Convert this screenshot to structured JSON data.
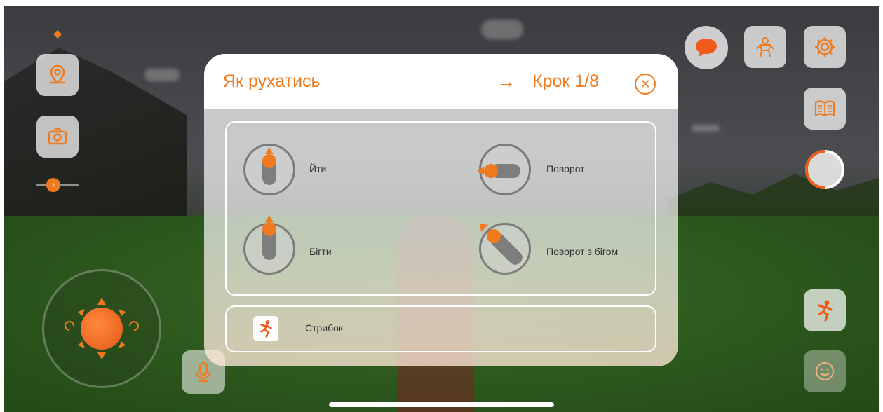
{
  "modal": {
    "title": "Як рухатись",
    "step_label": "Крок 1/8",
    "gestures": [
      {
        "label": "Йти"
      },
      {
        "label": "Поворот"
      },
      {
        "label": "Бігти"
      },
      {
        "label": "Поворот з бігом"
      }
    ],
    "jump": {
      "label": "Стрибок"
    }
  },
  "hud": {
    "progress_fraction": 0.5
  },
  "colors": {
    "accent": "#f07a1e",
    "modal_header_bg": "#ffffff",
    "panel_border": "#ffffff"
  },
  "icons": {
    "chat": "speech-bubble-icon",
    "avatar": "avatar-figure-icon",
    "settings": "gear-icon",
    "guide": "open-book-icon",
    "map": "map-pin-icon",
    "camera": "camera-icon",
    "volume": "speaker-icon",
    "microphone": "microphone-icon",
    "jump": "jumping-figure-icon",
    "emoji": "smiley-icon",
    "close": "close-icon",
    "next_step": "arrow-right-icon"
  }
}
